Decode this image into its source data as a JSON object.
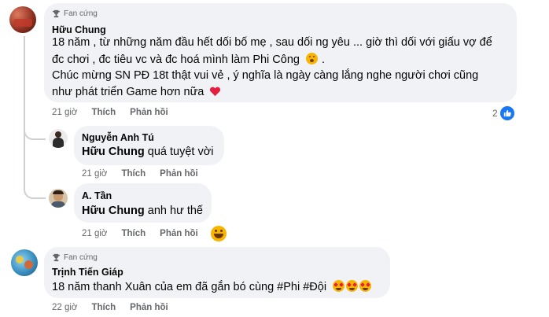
{
  "comments": [
    {
      "badge": "Fan cứng",
      "author": "Hữu Chung",
      "lines": [
        "18 năm , từ những năm đầu hết dối bố mẹ , sau dối ng yêu ... giờ thì dối với giấu vợ để",
        "đc chơi , đc tiêu vc và đc hoá mình làm Phi Công",
        ".",
        "Chúc mừng SN PĐ 18t thật vui vẻ , ý nghĩa là ngày càng lắng nghe người chơi cũng",
        "như phát triển Game hơn nữa"
      ],
      "time": "21 giờ",
      "like_label": "Thích",
      "reply_label": "Phản hồi",
      "reaction_count": "2"
    },
    {
      "author": "Nguyễn Anh Tú",
      "mention": "Hữu Chung",
      "text": "quá tuyệt vời",
      "time": "21 giờ",
      "like_label": "Thích",
      "reply_label": "Phản hồi"
    },
    {
      "author": "A. Tần",
      "mention": "Hữu Chung",
      "text": "anh hư thế",
      "time": "21 giờ",
      "like_label": "Thích",
      "reply_label": "Phản hồi"
    },
    {
      "badge": "Fan cứng",
      "author": "Trịnh Tiến Giáp",
      "text": "18 năm thanh Xuân của em đã gắn bó cùng #Phi #Đội",
      "time": "22 giờ",
      "like_label": "Thích",
      "reply_label": "Phản hồi"
    }
  ],
  "colors": {
    "bubble": "#f0f2f5",
    "meta_text": "#65676b",
    "like_blue": "#1877f2",
    "thread_line": "#ced0d4"
  }
}
